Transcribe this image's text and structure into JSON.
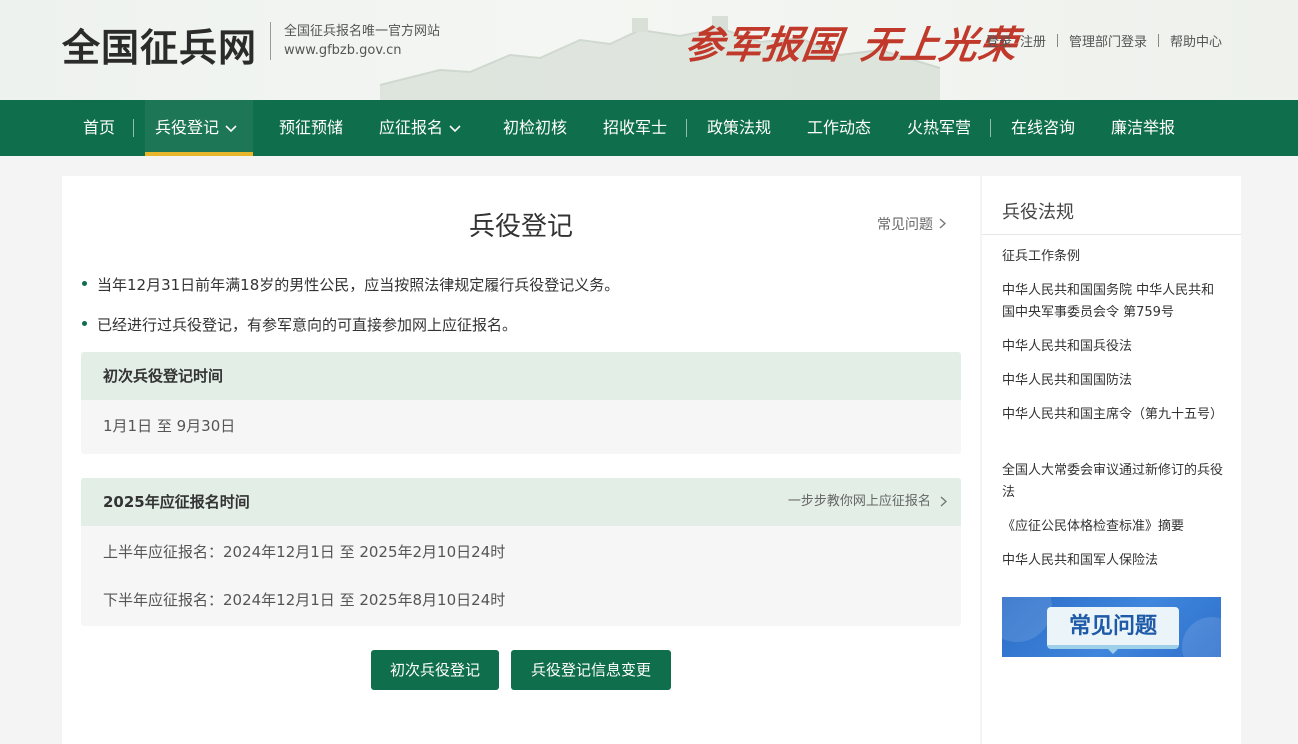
{
  "header": {
    "logo_title": "全国征兵网",
    "logo_subtitle": "全国征兵报名唯一官方网站",
    "logo_url": "www.gfbzb.gov.cn",
    "slogan_1": "参军报国",
    "slogan_2": "无上光荣",
    "links": {
      "login": "登录",
      "register": "注册",
      "admin_login": "管理部门登录",
      "help": "帮助中心"
    }
  },
  "nav": {
    "items": [
      {
        "label": "首页"
      },
      {
        "label": "兵役登记",
        "active": true,
        "dropdown": true
      },
      {
        "label": "预征预储"
      },
      {
        "label": "应征报名",
        "dropdown": true
      },
      {
        "label": "初检初核"
      },
      {
        "label": "招收军士"
      },
      {
        "label": "政策法规"
      },
      {
        "label": "工作动态"
      },
      {
        "label": "火热军营"
      },
      {
        "label": "在线咨询"
      },
      {
        "label": "廉洁举报"
      }
    ]
  },
  "main": {
    "title": "兵役登记",
    "faq_link": "常见问题",
    "bullets": [
      "当年12月31日前年满18岁的男性公民，应当按照法律规定履行兵役登记义务。",
      "已经进行过兵役登记，有参军意向的可直接参加网上应征报名。"
    ],
    "card_registration": {
      "heading": "初次兵役登记时间",
      "period": "1月1日 至 9月30日"
    },
    "card_application": {
      "heading": "2025年应征报名时间",
      "link": "一步步教你网上应征报名",
      "first_half": "上半年应征报名：2024年12月1日 至 2025年2月10日24时",
      "second_half": "下半年应征报名：2024年12月1日 至 2025年8月10日24时"
    },
    "buttons": {
      "register": "初次兵役登记",
      "change": "兵役登记信息变更"
    }
  },
  "sidebar": {
    "title": "兵役法规",
    "items": [
      "征兵工作条例",
      "中华人民共和国国务院 中华人民共和国中央军事委员会令 第759号",
      "中华人民共和国兵役法",
      "中华人民共和国国防法",
      "中华人民共和国主席令（第九十五号）",
      "全国人大常委会审议通过新修订的兵役法",
      "《应征公民体格检查标准》摘要",
      "中华人民共和国军人保险法"
    ],
    "banner_label": "常见问题"
  },
  "colors": {
    "brand_green": "#0f6e4c",
    "nav_active_underline": "#e7b62a",
    "slogan_red": "#c0392b"
  }
}
